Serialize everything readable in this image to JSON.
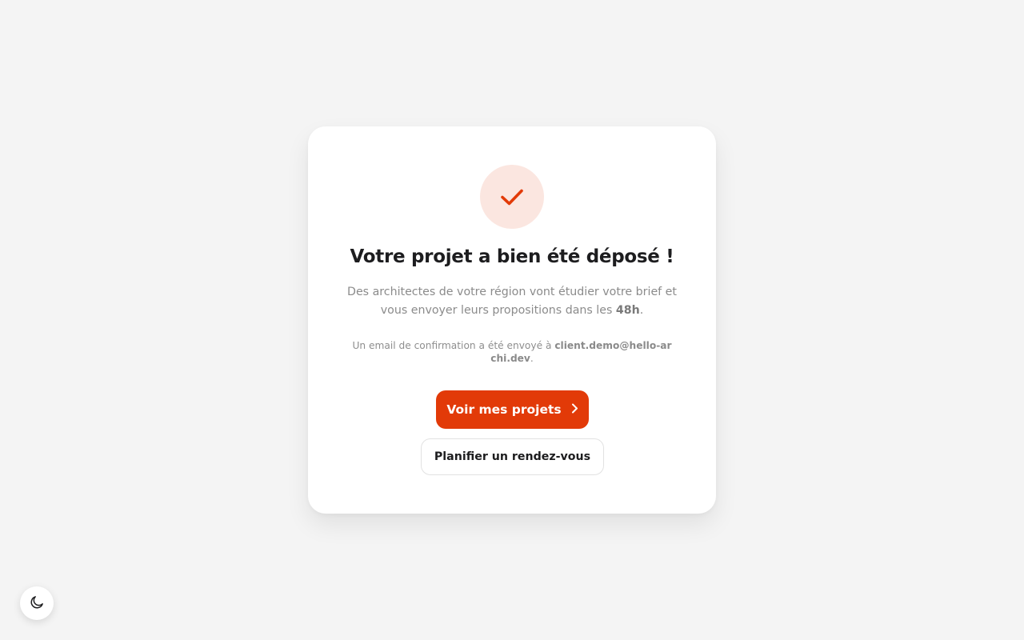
{
  "confirmation": {
    "title": "Votre projet a bien été déposé !",
    "description_before": "Des architectes de votre région vont étudier votre brief et vous envoyer leurs propositions dans les ",
    "description_highlight": "48h",
    "description_after": ".",
    "email_note_before": "Un email de confirmation a été envoyé à ",
    "email_address": "client.demo@hello-archi.dev",
    "email_note_after": "."
  },
  "actions": {
    "primary_label": "Voir mes projets",
    "secondary_label": "Planifier un rendez-vous"
  },
  "icons": {
    "success": "check-icon",
    "primary_arrow": "chevron-right-icon",
    "theme": "moon-icon"
  },
  "colors": {
    "accent": "#e23a08",
    "accent_soft": "#fbe6e0",
    "background": "#f4f4f4",
    "card": "#ffffff",
    "text": "#1d1d1f",
    "muted": "#8b8b8b"
  }
}
